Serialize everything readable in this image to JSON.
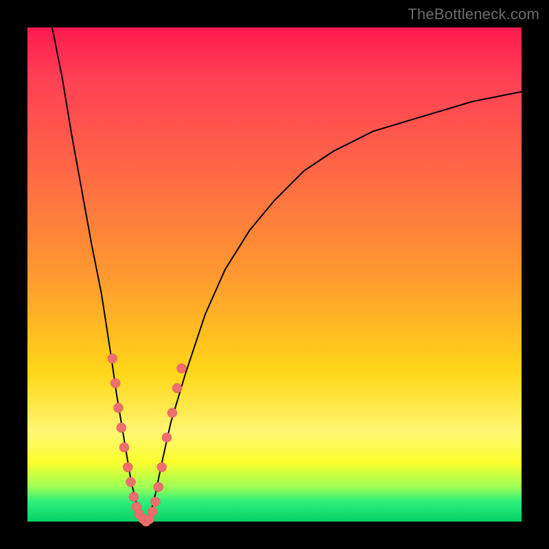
{
  "watermark": "TheBottleneck.com",
  "colors": {
    "gradient_top": "#ff1a4e",
    "gradient_mid": "#ffd718",
    "gradient_bottom": "#06d169",
    "curve": "#000000",
    "marker": "#ee6d6d",
    "frame": "#000000"
  },
  "chart_data": {
    "type": "line",
    "title": "",
    "xlabel": "",
    "ylabel": "",
    "xlim": [
      0,
      100
    ],
    "ylim": [
      0,
      100
    ],
    "note": "V-shaped bottleneck curve on red→green vertical gradient background; lower is better. Values estimated from pixel positions (no axes/ticks visible).",
    "series": [
      {
        "name": "bottleneck-curve-left",
        "x": [
          5,
          7,
          9,
          11,
          13,
          15,
          17,
          18,
          19,
          20,
          21,
          22,
          23,
          24
        ],
        "y": [
          100,
          90,
          78,
          67,
          56,
          46,
          33,
          26,
          20,
          14,
          8,
          4,
          1,
          0
        ]
      },
      {
        "name": "bottleneck-curve-right",
        "x": [
          24,
          25,
          26,
          27,
          29,
          32,
          36,
          40,
          45,
          50,
          56,
          62,
          70,
          80,
          90,
          100
        ],
        "y": [
          0,
          2,
          6,
          11,
          20,
          30,
          42,
          51,
          59,
          65,
          71,
          75,
          79,
          82,
          85,
          87
        ]
      }
    ],
    "markers": {
      "name": "sample-points",
      "note": "salmon dots along lower portion of curve; approximate coordinates",
      "points": [
        {
          "x": 17.2,
          "y": 33
        },
        {
          "x": 17.8,
          "y": 28
        },
        {
          "x": 18.4,
          "y": 23
        },
        {
          "x": 19.0,
          "y": 19
        },
        {
          "x": 19.6,
          "y": 15
        },
        {
          "x": 20.3,
          "y": 11
        },
        {
          "x": 20.9,
          "y": 8
        },
        {
          "x": 21.5,
          "y": 5
        },
        {
          "x": 22.1,
          "y": 3
        },
        {
          "x": 22.6,
          "y": 1.5
        },
        {
          "x": 23.4,
          "y": 0.5
        },
        {
          "x": 24.0,
          "y": 0
        },
        {
          "x": 24.7,
          "y": 0.5
        },
        {
          "x": 25.3,
          "y": 2
        },
        {
          "x": 25.9,
          "y": 4
        },
        {
          "x": 26.5,
          "y": 7
        },
        {
          "x": 27.2,
          "y": 11
        },
        {
          "x": 28.2,
          "y": 17
        },
        {
          "x": 29.3,
          "y": 22
        },
        {
          "x": 30.3,
          "y": 27
        },
        {
          "x": 31.2,
          "y": 31
        }
      ]
    }
  }
}
